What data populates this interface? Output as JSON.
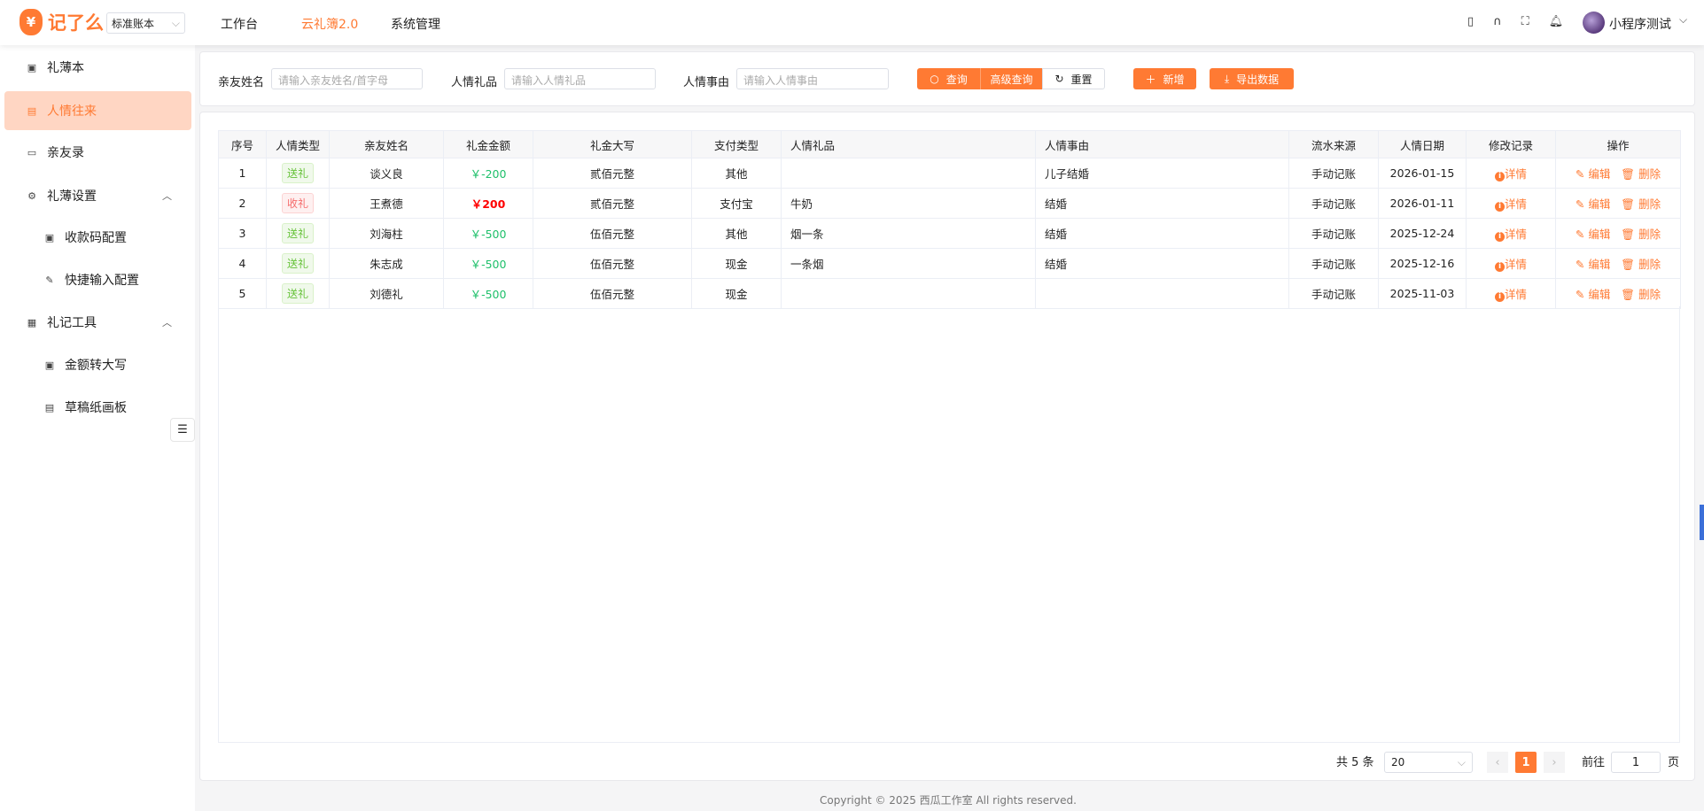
{
  "header": {
    "logo_text": "记了么",
    "logo_symbol": "¥",
    "book_select": "标准账本",
    "nav": [
      "工作台",
      "云礼簿2.0",
      "系统管理"
    ],
    "active_nav": 1,
    "user": "小程序测试",
    "icons": [
      "tablet-icon",
      "headset-icon",
      "fullscreen-icon",
      "bell-icon"
    ]
  },
  "sidebar": {
    "items": [
      {
        "label": "礼薄本",
        "icon": "book-icon"
      },
      {
        "label": "人情往来",
        "icon": "ledger-icon",
        "active": true
      },
      {
        "label": "亲友录",
        "icon": "folder-icon"
      },
      {
        "label": "礼薄设置",
        "icon": "gear-icon",
        "expandable": true
      },
      {
        "label": "收款码配置",
        "icon": "qr-icon",
        "sub": true
      },
      {
        "label": "快捷输入配置",
        "icon": "edit-icon",
        "sub": true
      },
      {
        "label": "礼记工具",
        "icon": "toolbox-icon",
        "expandable": true
      },
      {
        "label": "金额转大写",
        "icon": "money-icon",
        "sub": true
      },
      {
        "label": "草稿纸画板",
        "icon": "doc-icon",
        "sub": true
      }
    ]
  },
  "search": {
    "name_label": "亲友姓名",
    "name_placeholder": "请输入亲友姓名/首字母",
    "gift_label": "人情礼品",
    "gift_placeholder": "请输入人情礼品",
    "reason_label": "人情事由",
    "reason_placeholder": "请输入人情事由",
    "query": "查询",
    "advanced": "高级查询",
    "reset": "重置",
    "add": "新增",
    "export": "导出数据"
  },
  "table": {
    "columns": [
      "序号",
      "人情类型",
      "亲友姓名",
      "礼金金额",
      "礼金大写",
      "支付类型",
      "人情礼品",
      "人情事由",
      "流水来源",
      "人情日期",
      "修改记录",
      "操作"
    ],
    "rows": [
      {
        "no": "1",
        "type": "送礼",
        "name": "谈义良",
        "amount": "￥-200",
        "upper": "贰佰元整",
        "pay": "其他",
        "gift": "",
        "reason": "儿子结婚",
        "source": "手动记账",
        "date": "2026-01-15"
      },
      {
        "no": "2",
        "type": "收礼",
        "name": "王煮德",
        "amount": "￥200",
        "upper": "贰佰元整",
        "pay": "支付宝",
        "gift": "牛奶",
        "reason": "结婚",
        "source": "手动记账",
        "date": "2026-01-11"
      },
      {
        "no": "3",
        "type": "送礼",
        "name": "刘海柱",
        "amount": "￥-500",
        "upper": "伍佰元整",
        "pay": "其他",
        "gift": "烟一条",
        "reason": "结婚",
        "source": "手动记账",
        "date": "2025-12-24"
      },
      {
        "no": "4",
        "type": "送礼",
        "name": "朱志成",
        "amount": "￥-500",
        "upper": "伍佰元整",
        "pay": "现金",
        "gift": "一条烟",
        "reason": "结婚",
        "source": "手动记账",
        "date": "2025-12-16"
      },
      {
        "no": "5",
        "type": "送礼",
        "name": "刘德礼",
        "amount": "￥-500",
        "upper": "伍佰元整",
        "pay": "现金",
        "gift": "",
        "reason": "",
        "source": "手动记账",
        "date": "2025-11-03"
      }
    ],
    "detail": "详情",
    "edit": "编辑",
    "delete": "删除"
  },
  "pagination": {
    "total": "共 5 条",
    "page_size": "20",
    "current": "1",
    "goto_label": "前往",
    "goto_value": "1",
    "page_suffix": "页"
  },
  "footer": {
    "copyright": "Copyright © 2025 西瓜工作室 All rights reserved."
  },
  "colors": {
    "accent": "#ff7a33",
    "give": "#67c23a",
    "receive": "#f56c6c",
    "negative": "#1fc06b",
    "positive": "#ff0000"
  }
}
